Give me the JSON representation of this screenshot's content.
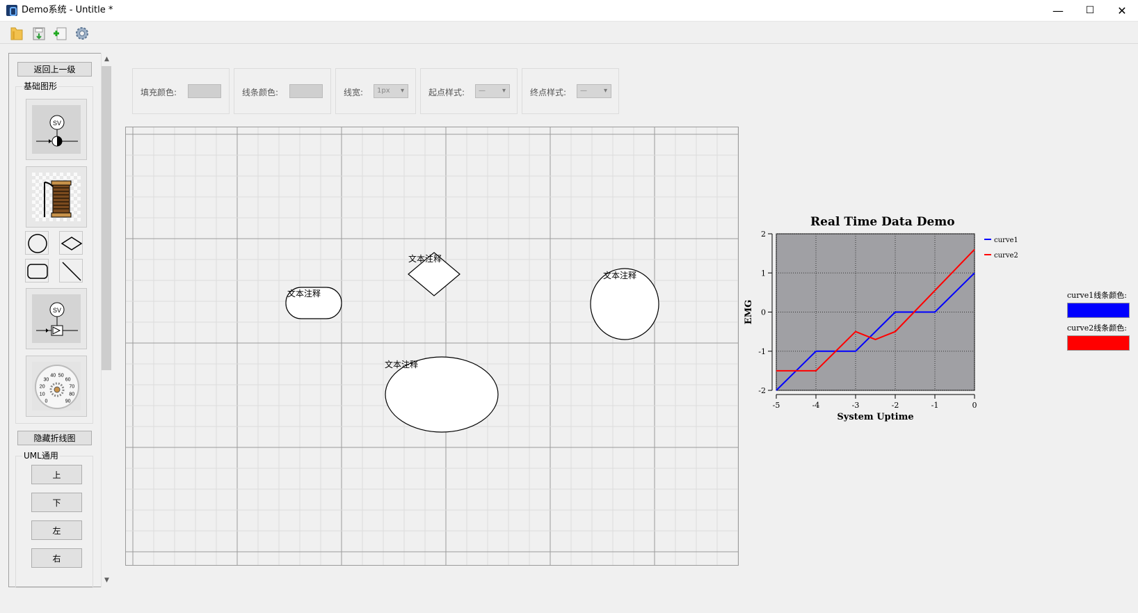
{
  "window": {
    "title": "Demo系统 - Untitle *",
    "minimize": "—",
    "maximize": "☐",
    "close": "✕"
  },
  "toolbar": {
    "items": [
      {
        "icon": "open-folder-icon"
      },
      {
        "icon": "save-icon"
      },
      {
        "icon": "new-file-icon"
      },
      {
        "icon": "settings-gear-icon"
      }
    ]
  },
  "sidebar": {
    "back_label": "返回上一级",
    "basic_group_label": "基础图形",
    "hide_chart_label": "隐藏折线图",
    "uml_group_label": "UML通用",
    "dir_buttons": [
      "上",
      "下",
      "左",
      "右"
    ],
    "tiles": [
      "sv-valve-sensor",
      "thread-spool",
      "sv-check-valve",
      "gauge-dial"
    ],
    "shapes": [
      "circle-shape",
      "diamond-shape",
      "rounded-rect-shape",
      "line-shape"
    ],
    "sv_text": "SV",
    "gauge_ticks": [
      "0",
      "10",
      "20",
      "30",
      "40",
      "50",
      "60",
      "70",
      "80",
      "90"
    ]
  },
  "properties": {
    "fill_color_label": "填充颜色:",
    "line_color_label": "线条颜色:",
    "line_width_label": "线宽:",
    "line_width_value": "1px",
    "start_style_label": "起点样式:",
    "start_style_value": "—",
    "end_style_label": "终点样式:",
    "end_style_value": "—"
  },
  "canvas": {
    "notes": [
      "文本注释",
      "文本注释",
      "文本注释",
      "文本注释"
    ]
  },
  "chart_data": {
    "type": "line",
    "title": "Real Time Data Demo",
    "xlabel": "System Uptime",
    "ylabel": "EMG",
    "xlim": [
      -5,
      0
    ],
    "ylim": [
      -2,
      2
    ],
    "xticks": [
      "-5",
      "-4",
      "-3",
      "-2",
      "-1",
      "0"
    ],
    "yticks": [
      "2",
      "1",
      "0",
      "-1",
      "-2"
    ],
    "grid": true,
    "legend": "right",
    "background": "#a0a0a4",
    "series": [
      {
        "name": "curve1",
        "color": "#0000ff",
        "x": [
          -5,
          -4,
          -3,
          -2,
          -1,
          0
        ],
        "y": [
          -2,
          -1,
          -1,
          0,
          0,
          1
        ]
      },
      {
        "name": "curve2",
        "color": "#ff0000",
        "x": [
          -5,
          -4,
          -3,
          -2.5,
          -2,
          0
        ],
        "y": [
          -1.5,
          -1.5,
          -0.5,
          -0.7,
          -0.5,
          1.6
        ]
      }
    ]
  },
  "curve_colors": {
    "curve1_label": "curve1线条颜色:",
    "curve1_color": "#0000ff",
    "curve2_label": "curve2线条颜色:",
    "curve2_color": "#ff0000"
  }
}
